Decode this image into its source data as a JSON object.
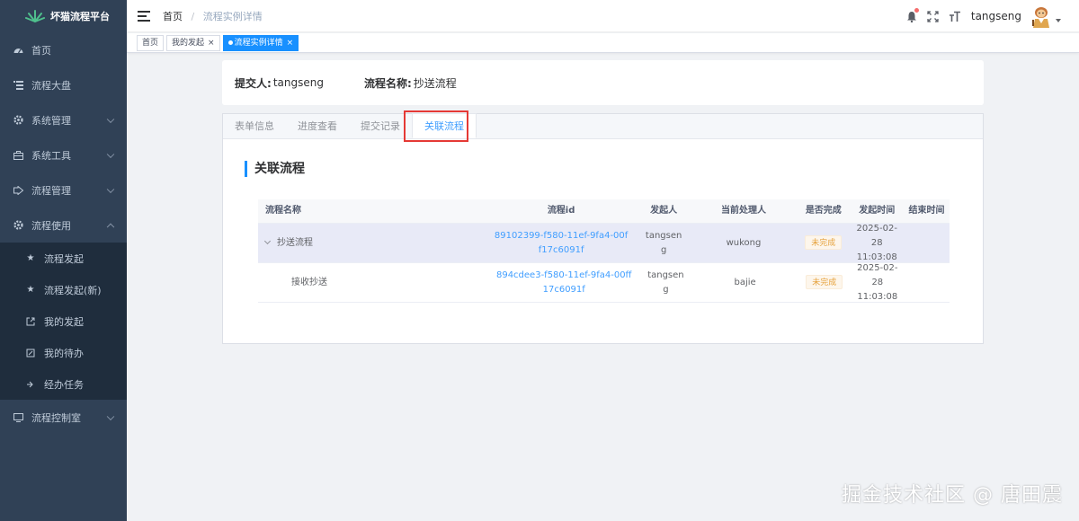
{
  "sidebar": {
    "logo_text": "坏猫流程平台",
    "items": [
      {
        "label": "首页",
        "icon": "dashboard-icon"
      },
      {
        "label": "流程大盘",
        "icon": "list-icon"
      },
      {
        "label": "系统管理",
        "icon": "gear-icon"
      },
      {
        "label": "系统工具",
        "icon": "toolbox-icon"
      },
      {
        "label": "流程管理",
        "icon": "flow-icon"
      },
      {
        "label": "流程使用",
        "icon": "gear-icon"
      }
    ],
    "sub_items": [
      {
        "label": "流程发起",
        "icon": "star-icon"
      },
      {
        "label": "流程发起(新)",
        "icon": "star-icon"
      },
      {
        "label": "我的发起",
        "icon": "external-link-icon"
      },
      {
        "label": "我的待办",
        "icon": "edit-icon"
      },
      {
        "label": "经办任务",
        "icon": "arrow-in-icon"
      }
    ],
    "last_item": {
      "label": "流程控制室",
      "icon": "monitor-icon"
    }
  },
  "header": {
    "breadcrumb_home": "首页",
    "breadcrumb_sep": "/",
    "breadcrumb_current": "流程实例详情",
    "username": "tangseng"
  },
  "tags": [
    {
      "label": "首页",
      "closable": false,
      "active": false
    },
    {
      "label": "我的发起",
      "closable": true,
      "active": false
    },
    {
      "label": "流程实例详情",
      "closable": true,
      "active": true
    }
  ],
  "summary": {
    "submitter_label": "提交人:",
    "submitter": "tangseng",
    "process_label": "流程名称:",
    "process_name": "抄送流程"
  },
  "tabs": [
    "表单信息",
    "进度查看",
    "提交记录",
    "关联流程"
  ],
  "active_tab": "关联流程",
  "section_title": "关联流程",
  "table": {
    "headers": [
      "流程名称",
      "流程id",
      "发起人",
      "当前处理人",
      "是否完成",
      "发起时间",
      "结束时间"
    ],
    "rows": [
      {
        "name": "抄送流程",
        "id_line1": "89102399-f580-11ef-9fa4-00f",
        "id_line2": "f17c6091f",
        "starter_line1": "tangsen",
        "starter_line2": "g",
        "handler": "wukong",
        "status": "未完成",
        "start_date": "2025-02-28",
        "start_time": "11:03:08",
        "end": ""
      },
      {
        "name": "接收抄送",
        "id_line1": "894cdee3-f580-11ef-9fa4-00ff",
        "id_line2": "17c6091f",
        "starter_line1": "tangsen",
        "starter_line2": "g",
        "handler": "bajie",
        "status": "未完成",
        "start_date": "2025-02-28",
        "start_time": "11:03:08",
        "end": ""
      }
    ]
  },
  "watermark": "掘金技术社区 @ 唐田震"
}
